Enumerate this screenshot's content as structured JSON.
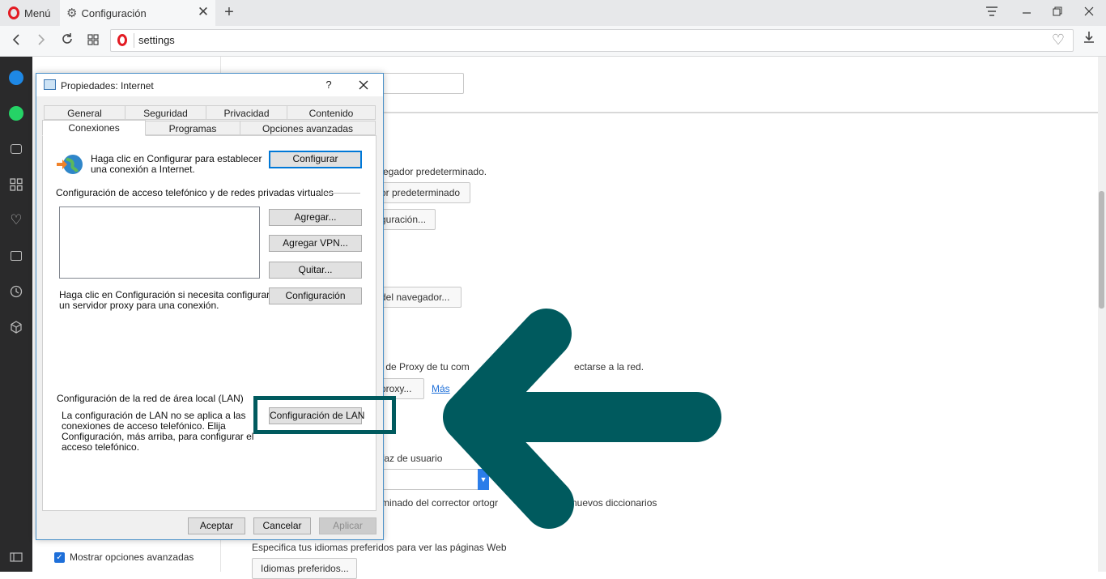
{
  "browser": {
    "menu_label": "Menú",
    "tab_title": "Configuración",
    "address": "settings",
    "accent_color": "#e31b23"
  },
  "sidebar_icons": [
    "messenger-icon",
    "whatsapp-icon",
    "camera-icon",
    "speed-dial-icon",
    "heart-icon",
    "news-icon",
    "history-icon",
    "extensions-icon",
    "sidebar-toggle-icon"
  ],
  "settings": {
    "show_advanced_label": "Mostrar opciones avanzadas",
    "show_advanced_checked": true,
    "default_browser_text": "vegador predeterminado.",
    "make_default_button": "or predeterminado",
    "config_button": "guración...",
    "browser_button": "del navegador...",
    "proxy_text": "s de Proxy de tu com",
    "proxy_text_tail": "ectarse a la red.",
    "proxy_button": "proxy...",
    "more_link": "Más",
    "ui_language_text": "rfaz de usuario",
    "spellcheck_text": "rminado del corrector ortogr",
    "spellcheck_tail": "nuevos diccionarios",
    "preferred_languages_text": "Especifica tus idiomas preferidos para ver las páginas Web",
    "preferred_languages_button": "Idiomas preferidos..."
  },
  "dialog": {
    "title": "Propiedades: Internet",
    "help": "?",
    "tabs_row1": [
      "General",
      "Seguridad",
      "Privacidad",
      "Contenido"
    ],
    "tabs_row2": [
      "Conexiones",
      "Programas",
      "Opciones avanzadas"
    ],
    "active_tab": "Conexiones",
    "setup_text_1": "Haga clic en Configurar para establecer",
    "setup_text_2": "una conexión a Internet.",
    "setup_button": "Configurar",
    "dialup_heading": "Configuración de acceso telefónico y de redes privadas virtuales",
    "add_button": "Agregar...",
    "add_vpn_button": "Agregar VPN...",
    "remove_button": "Quitar...",
    "settings_button": "Configuración",
    "proxy_text_1": "Haga clic en Configuración si necesita configurar",
    "proxy_text_2": "un servidor proxy para una conexión.",
    "lan_heading": "Configuración de la red de área local (LAN)",
    "lan_text_1": "La configuración de LAN no se aplica a las",
    "lan_text_2": "conexiones de acceso telefónico. Elija",
    "lan_text_3": "Configuración, más arriba, para configurar el",
    "lan_text_4": "acceso telefónico.",
    "lan_button": "Configuración de LAN",
    "ok_button": "Aceptar",
    "cancel_button": "Cancelar",
    "apply_button": "Aplicar"
  },
  "annotation": {
    "color": "#005a5e"
  }
}
